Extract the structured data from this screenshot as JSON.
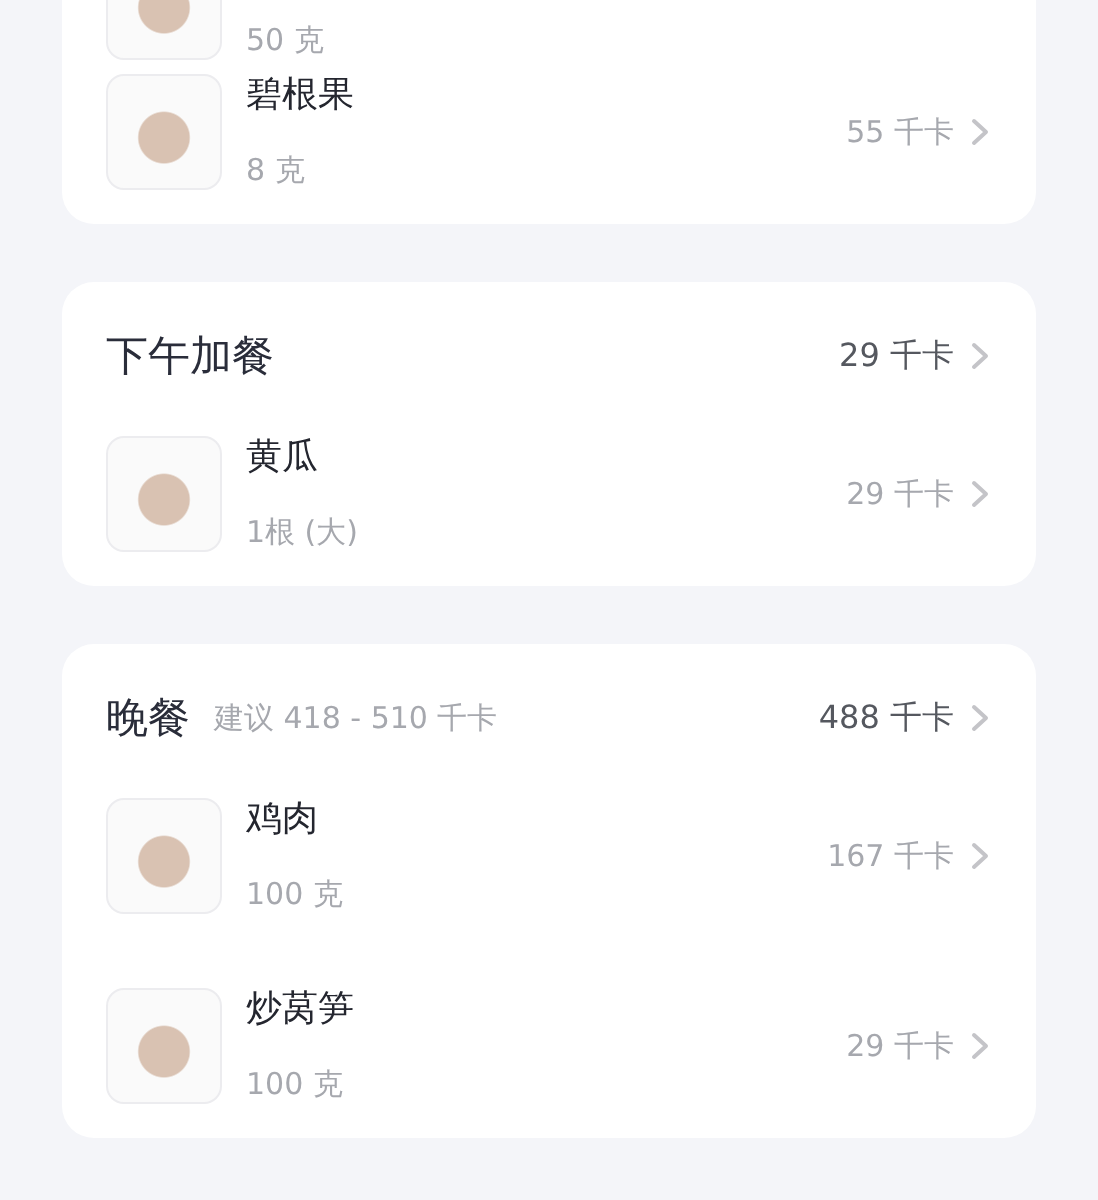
{
  "meals": [
    {
      "items": [
        {
          "amount": "50 克"
        },
        {
          "name": "碧根果",
          "amount": "8 克",
          "kcal": "55 千卡"
        }
      ]
    },
    {
      "title": "下午加餐",
      "total": "29 千卡",
      "items": [
        {
          "name": "黄瓜",
          "amount": "1根 (大)",
          "kcal": "29 千卡"
        }
      ]
    },
    {
      "title": "晚餐",
      "suggestion": "建议 418 - 510 千卡",
      "total": "488 千卡",
      "items": [
        {
          "name": "鸡肉",
          "amount": "100 克",
          "kcal": "167 千卡"
        },
        {
          "name": "炒莴笋",
          "amount": "100 克",
          "kcal": "29 千卡"
        }
      ]
    }
  ]
}
